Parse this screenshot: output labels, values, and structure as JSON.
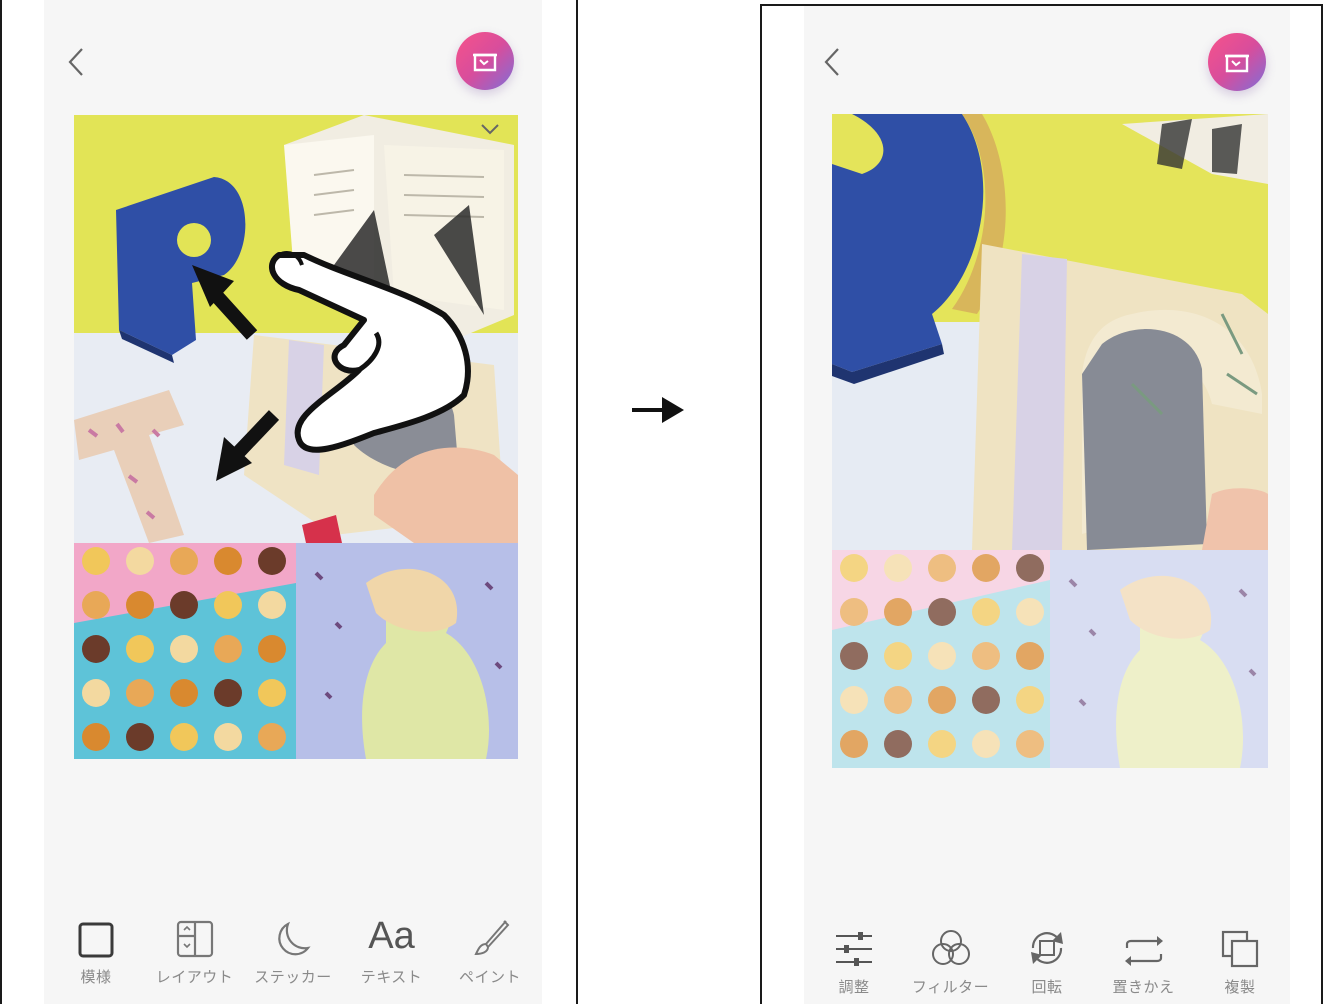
{
  "before": {
    "toolbar": [
      {
        "key": "pattern",
        "label": "模様",
        "icon": "square-frame-icon"
      },
      {
        "key": "layout",
        "label": "レイアウト",
        "icon": "layout-grid-icon"
      },
      {
        "key": "sticker",
        "label": "ステッカー",
        "icon": "moon-sticker-icon"
      },
      {
        "key": "text",
        "label": "テキスト",
        "icon": "text-aa-icon"
      },
      {
        "key": "paint",
        "label": "ペイント",
        "icon": "brush-icon"
      }
    ],
    "text_icon_glyph": "Aa",
    "gesture": "pinch-out"
  },
  "after": {
    "toolbar": [
      {
        "key": "adjust",
        "label": "調整",
        "icon": "sliders-icon"
      },
      {
        "key": "filter",
        "label": "フィルター",
        "icon": "filter-circles-icon"
      },
      {
        "key": "rotate",
        "label": "回転",
        "icon": "rotate-icon"
      },
      {
        "key": "replace",
        "label": "置きかえ",
        "icon": "swap-icon"
      },
      {
        "key": "duplicate",
        "label": "複製",
        "icon": "duplicate-icon"
      }
    ]
  },
  "colors": {
    "accent_gradient": [
      "#f7538a",
      "#d84d9c",
      "#7f6ed8"
    ],
    "toolbar_icon": "#3a3a3a",
    "toolbar_label": "#8a8a8a",
    "screen_background": "#f6f6f6"
  }
}
